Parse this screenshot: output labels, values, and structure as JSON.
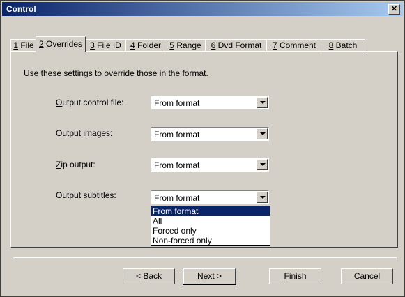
{
  "window": {
    "title": "Control",
    "close_glyph": "✕"
  },
  "tabs": [
    {
      "key": "1",
      "label": " File"
    },
    {
      "key": "2",
      "label": " Overrides"
    },
    {
      "key": "3",
      "label": " File ID"
    },
    {
      "key": "4",
      "label": " Folder"
    },
    {
      "key": "5",
      "label": " Range"
    },
    {
      "key": "6",
      "label": " Dvd Format"
    },
    {
      "key": "7",
      "label": " Comment"
    },
    {
      "key": "8",
      "label": " Batch"
    }
  ],
  "active_tab_index": 1,
  "overrides": {
    "intro": "Use these settings to override those in the format.",
    "rows": [
      {
        "acc": "O",
        "rest": "utput control file:",
        "value": "From format"
      },
      {
        "pre": "Output ",
        "acc": "i",
        "rest": "mages:",
        "value": "From format"
      },
      {
        "acc": "Z",
        "rest": "ip output:",
        "value": "From format"
      },
      {
        "pre": "Output ",
        "acc": "s",
        "rest": "ubtitles:",
        "value": "From format"
      }
    ],
    "subtitle_options": [
      "From format",
      "All",
      "Forced only",
      "Non-forced only"
    ],
    "subtitle_selected_index": 0
  },
  "buttons": {
    "back_pre": "< ",
    "back_acc": "B",
    "back_rest": "ack",
    "next_acc": "N",
    "next_rest": "ext >",
    "finish_acc": "F",
    "finish_rest": "inish",
    "cancel": "Cancel"
  }
}
